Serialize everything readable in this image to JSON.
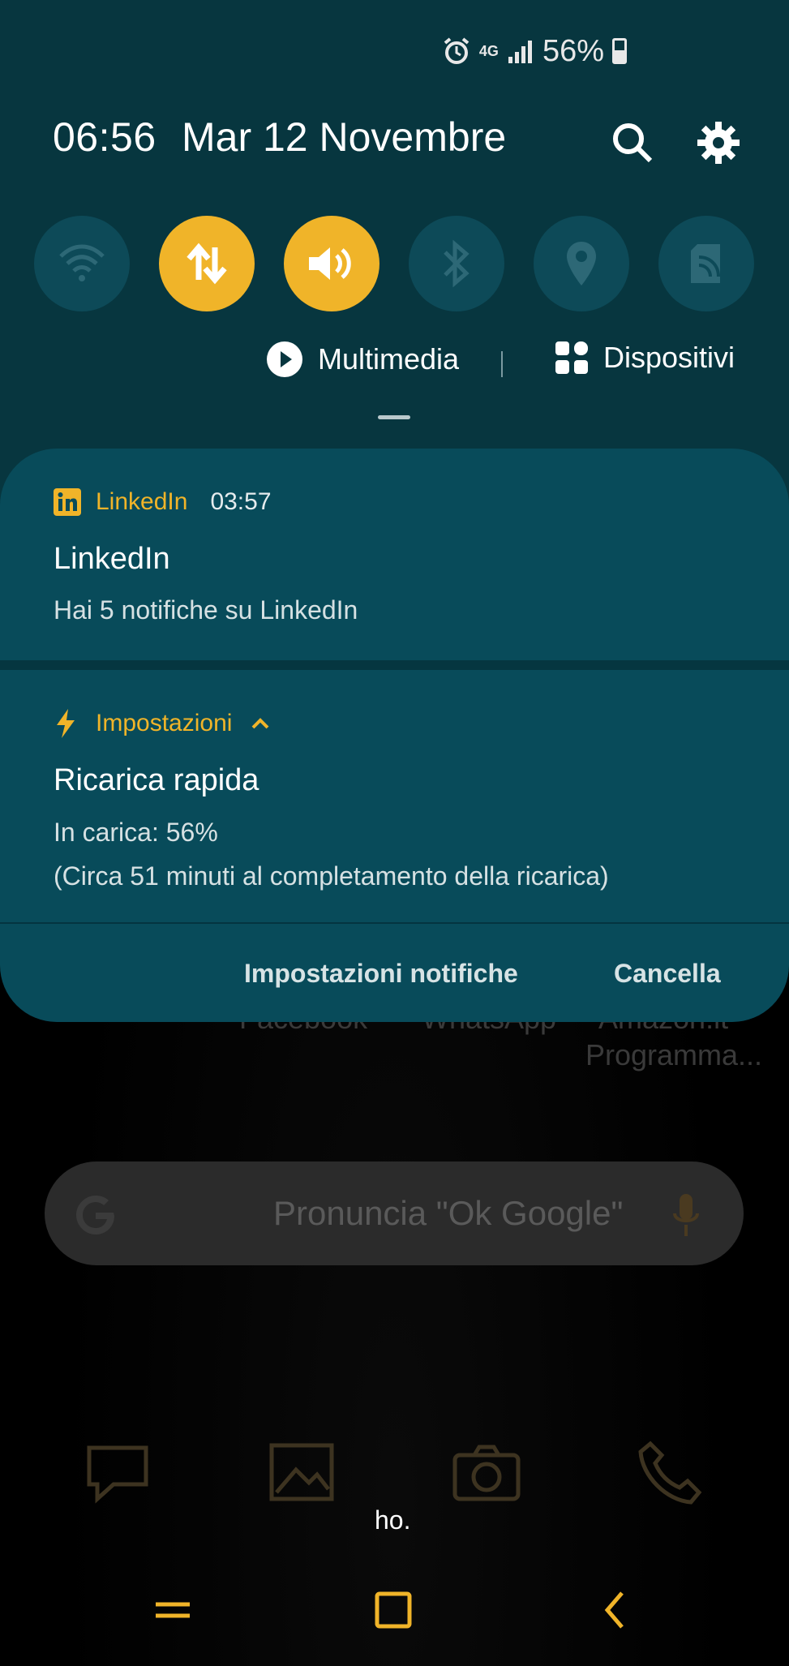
{
  "status_bar": {
    "network": "4G",
    "battery": "56%"
  },
  "header": {
    "time": "06:56",
    "date": "Mar 12 Novembre"
  },
  "quick_toggles": [
    {
      "name": "wifi",
      "active": false
    },
    {
      "name": "mobile-data",
      "active": true
    },
    {
      "name": "sound",
      "active": true
    },
    {
      "name": "bluetooth",
      "active": false
    },
    {
      "name": "location",
      "active": false
    },
    {
      "name": "screen-cast",
      "active": false
    }
  ],
  "media_row": {
    "multimedia_label": "Multimedia",
    "devices_label": "Dispositivi"
  },
  "notifications": [
    {
      "app": "LinkedIn",
      "time": "03:57",
      "title": "LinkedIn",
      "text": "Hai 5 notifiche su LinkedIn"
    },
    {
      "app": "Impostazioni",
      "title": "Ricarica rapida",
      "line1": "In carica: 56%",
      "line2": "(Circa 51 minuti al completamento della ricarica)"
    }
  ],
  "actions": {
    "settings_label": "Impostazioni notifiche",
    "clear_label": "Cancella"
  },
  "home_ghost": {
    "apps": [
      "Facebook",
      "WhatsApp",
      "Amazon.it",
      "Programma..."
    ],
    "search_placeholder": "Pronuncia \"Ok Google\""
  },
  "hint_text": "ho.",
  "colors": {
    "panel": "#07363f",
    "card": "#084b5a",
    "accent": "#f0b429"
  }
}
